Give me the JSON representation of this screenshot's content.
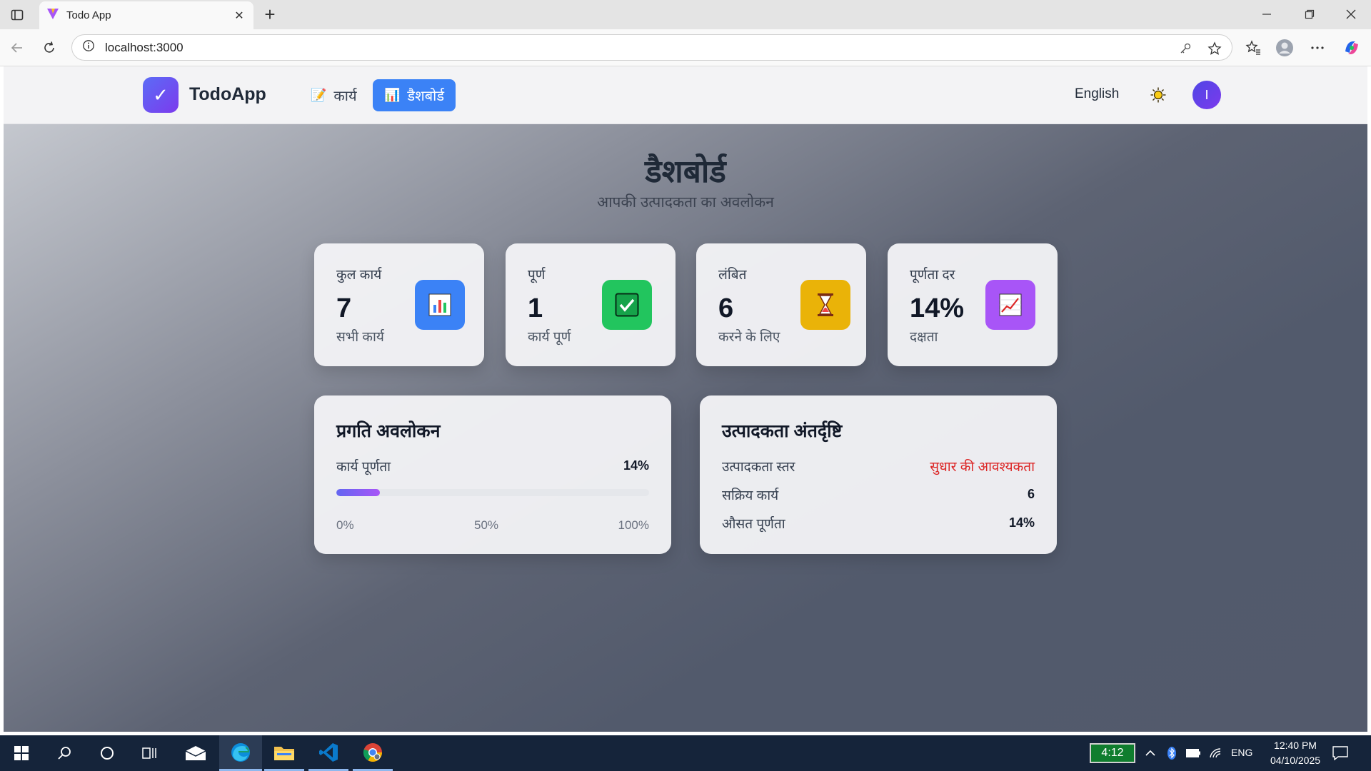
{
  "browser": {
    "tab_title": "Todo App",
    "url": "localhost:3000"
  },
  "app": {
    "logo_text": "TodoApp",
    "logo_check": "✓",
    "nav": [
      {
        "label": "कार्य",
        "icon": "memo-icon",
        "icon_glyph": "📝"
      },
      {
        "label": "डैशबोर्ड",
        "icon": "bar-chart-icon",
        "icon_glyph": "📊"
      }
    ],
    "language_button": "English",
    "avatar_initial": "I"
  },
  "dashboard": {
    "title": "डैशबोर्ड",
    "subtitle": "आपकी उत्पादकता का अवलोकन",
    "stats": [
      {
        "label": "कुल कार्य",
        "value": "7",
        "sub": "सभी कार्य",
        "icon": "bar-chart-icon",
        "color": "#3b82f6"
      },
      {
        "label": "पूर्ण",
        "value": "1",
        "sub": "कार्य पूर्ण",
        "icon": "check-box-icon",
        "color": "#22c55e"
      },
      {
        "label": "लंबित",
        "value": "6",
        "sub": "करने के लिए",
        "icon": "hourglass-icon",
        "color": "#eab308"
      },
      {
        "label": "पूर्णता दर",
        "value": "14%",
        "sub": "दक्षता",
        "icon": "trend-up-icon",
        "color": "#a855f7"
      }
    ],
    "progress_panel": {
      "title": "प्रगति अवलोकन",
      "label": "कार्य पूर्णता",
      "value_text": "14%",
      "progress_fraction": 0.14,
      "ticks": [
        "0%",
        "50%",
        "100%"
      ]
    },
    "insights_panel": {
      "title": "उत्पादकता अंतर्दृष्टि",
      "rows": [
        {
          "label": "उत्पादकता स्तर",
          "value": "सुधार की आवश्यकता",
          "color": "#dc2626"
        },
        {
          "label": "सक्रिय कार्य",
          "value": "6"
        },
        {
          "label": "औसत पूर्णता",
          "value": "14%"
        }
      ]
    }
  },
  "taskbar": {
    "battery_time": "4:12",
    "language": "ENG",
    "time": "12:40 PM",
    "date": "04/10/2025"
  }
}
